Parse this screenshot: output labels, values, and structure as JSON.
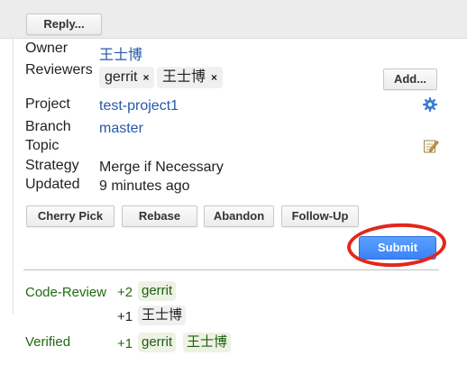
{
  "header": {
    "reply_label": "Reply..."
  },
  "info": {
    "owner_label": "Owner",
    "owner_value": "王士博",
    "reviewers_label": "Reviewers",
    "reviewers": [
      {
        "name": "gerrit",
        "remove": "×"
      },
      {
        "name": "王士博",
        "remove": "×"
      }
    ],
    "add_label": "Add...",
    "project_label": "Project",
    "project_value": "test-project1",
    "branch_label": "Branch",
    "branch_value": "master",
    "topic_label": "Topic",
    "strategy_label": "Strategy",
    "strategy_value": "Merge if Necessary",
    "updated_label": "Updated",
    "updated_value": "9 minutes ago"
  },
  "actions": {
    "cherry_pick": "Cherry Pick",
    "rebase": "Rebase",
    "abandon": "Abandon",
    "follow_up": "Follow-Up",
    "submit": "Submit"
  },
  "labels": {
    "code_review": {
      "name": "Code-Review",
      "votes": [
        {
          "score": "+2",
          "voters": [
            "gerrit"
          ]
        },
        {
          "score": "+1",
          "voters": [
            "王士博"
          ]
        }
      ]
    },
    "verified": {
      "name": "Verified",
      "votes": [
        {
          "score": "+1",
          "voters": [
            "gerrit",
            "王士博"
          ]
        }
      ]
    }
  },
  "icons": {
    "project_settings": "gear-icon",
    "topic_edit": "edit-icon"
  },
  "colors": {
    "link": "#2459a8",
    "submit_bg": "#3b82f6",
    "highlight_ring": "#e3261c",
    "vote_green": "#1f6b10"
  }
}
